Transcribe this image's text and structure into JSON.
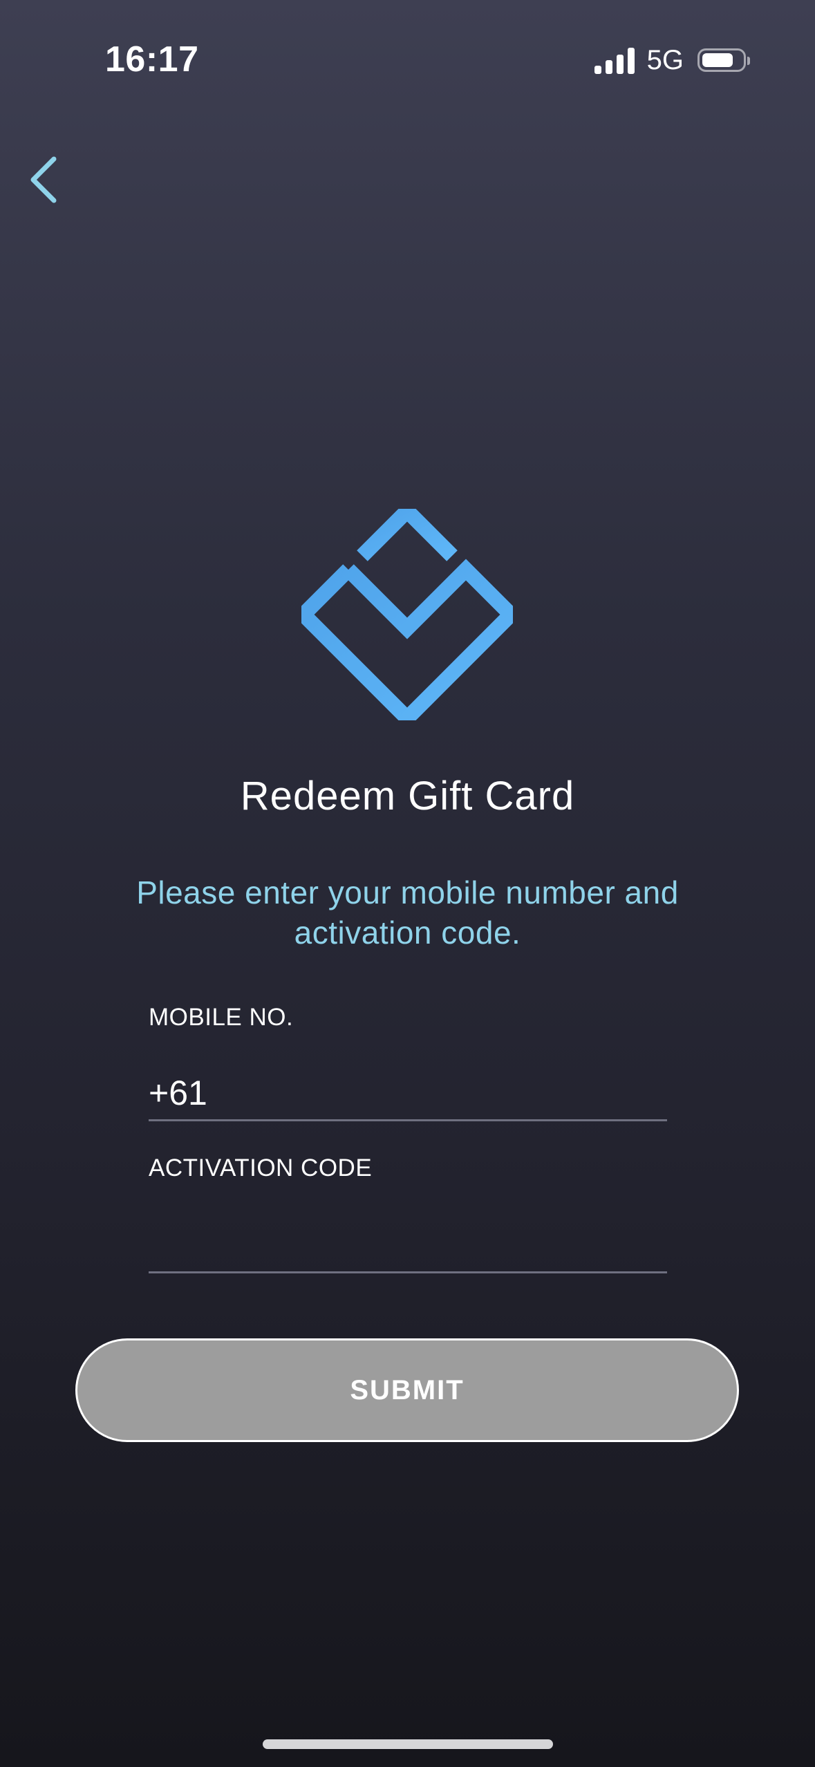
{
  "status_bar": {
    "time": "16:17",
    "network": "5G",
    "signal_bars": 4,
    "battery_level": 0.75
  },
  "header": {
    "back_icon": "chevron-left-icon"
  },
  "logo": {
    "icon": "diamond-chevron-logo",
    "color": "#55aaf0"
  },
  "page": {
    "title": "Redeem Gift Card",
    "subtitle": "Please enter your mobile number and activation code."
  },
  "form": {
    "mobile": {
      "label": "MOBILE NO.",
      "value": "+61"
    },
    "activation": {
      "label": "ACTIVATION CODE",
      "value": ""
    },
    "submit_label": "SUBMIT"
  },
  "colors": {
    "accent": "#8fd3ea",
    "button_disabled": "#9d9d9d",
    "logo_blue": "#55aaf0"
  }
}
